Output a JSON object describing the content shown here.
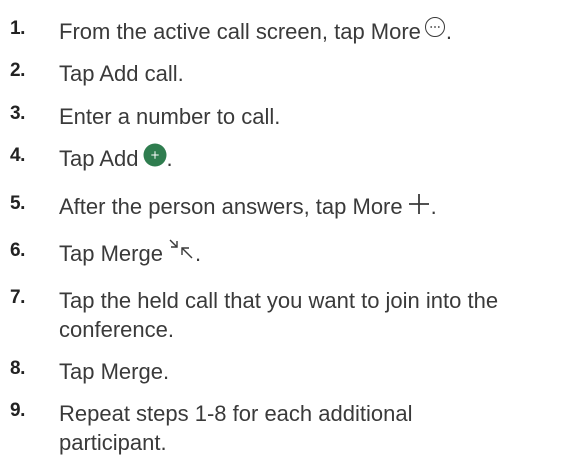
{
  "steps": [
    {
      "number": "1.",
      "text": "From the active call screen, tap More",
      "suffix": ".",
      "icon": "more-icon"
    },
    {
      "number": "2.",
      "text": "Tap Add call."
    },
    {
      "number": "3.",
      "text": "Enter a number to call."
    },
    {
      "number": "4.",
      "text": "Tap Add",
      "suffix": ".",
      "icon": "add-circle-icon"
    },
    {
      "number": "5.",
      "text": "After the person answers, tap More",
      "suffix": ".",
      "icon": "plus-icon"
    },
    {
      "number": "6.",
      "text": "Tap Merge",
      "suffix": ".",
      "icon": "merge-icon"
    },
    {
      "number": "7.",
      "text": "Tap the held call that you want to join into the",
      "text2": "conference."
    },
    {
      "number": "8.",
      "text": "Tap Merge."
    },
    {
      "number": "9.",
      "text": "Repeat steps 1-8 for each additional",
      "text2": "participant."
    }
  ],
  "colors": {
    "text": "#3a3a3a",
    "number": "#222222",
    "add_icon_fill": "#2f7d4f",
    "icon_stroke": "#3a3a3a"
  }
}
